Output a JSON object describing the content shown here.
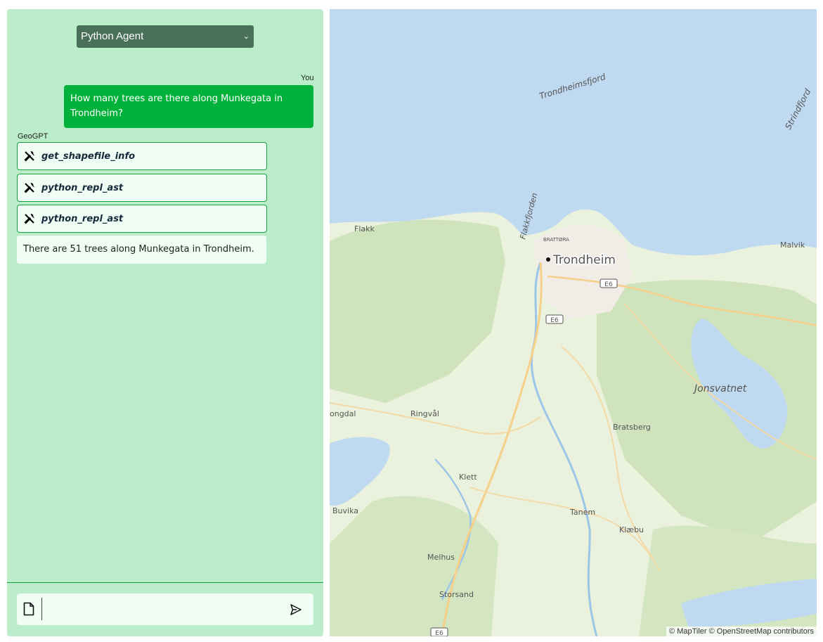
{
  "sidebar": {
    "agent_select": {
      "value": "Python Agent"
    },
    "messages": {
      "user_label": "You",
      "user_text": "How many trees are there along Munkegata in Trondheim?",
      "bot_label": "GeoGPT",
      "tools": [
        "get_shapefile_info",
        "python_repl_ast",
        "python_repl_ast"
      ],
      "answer": "There are 51 trees along Munkegata in Trondheim."
    },
    "input": {
      "placeholder": "",
      "value": ""
    }
  },
  "map": {
    "places": {
      "trondheim": "Trondheim",
      "flakk": "Flakk",
      "malvik": "Malvik",
      "bratsberg": "Bratsberg",
      "ringval": "Ringvål",
      "ongdal": "ongdal",
      "klett": "Klett",
      "buvika": "Buvika",
      "tanem": "Tanem",
      "klaebu": "Klæbu",
      "melhus": "Melhus",
      "storsand": "Storsand",
      "brattora": "BRATTØRA"
    },
    "water": {
      "trondheimsfjord": "Trondheimsfjord",
      "strindfjord": "Strindfjord",
      "flakkfjorden": "Flakkfjorden",
      "jonsvatnet": "Jonsvatnet"
    },
    "roads": {
      "e6_1": "E6",
      "e6_2": "E6",
      "e6_3": "E6"
    },
    "attribution": "© MapTiler © OpenStreetMap contributors"
  }
}
